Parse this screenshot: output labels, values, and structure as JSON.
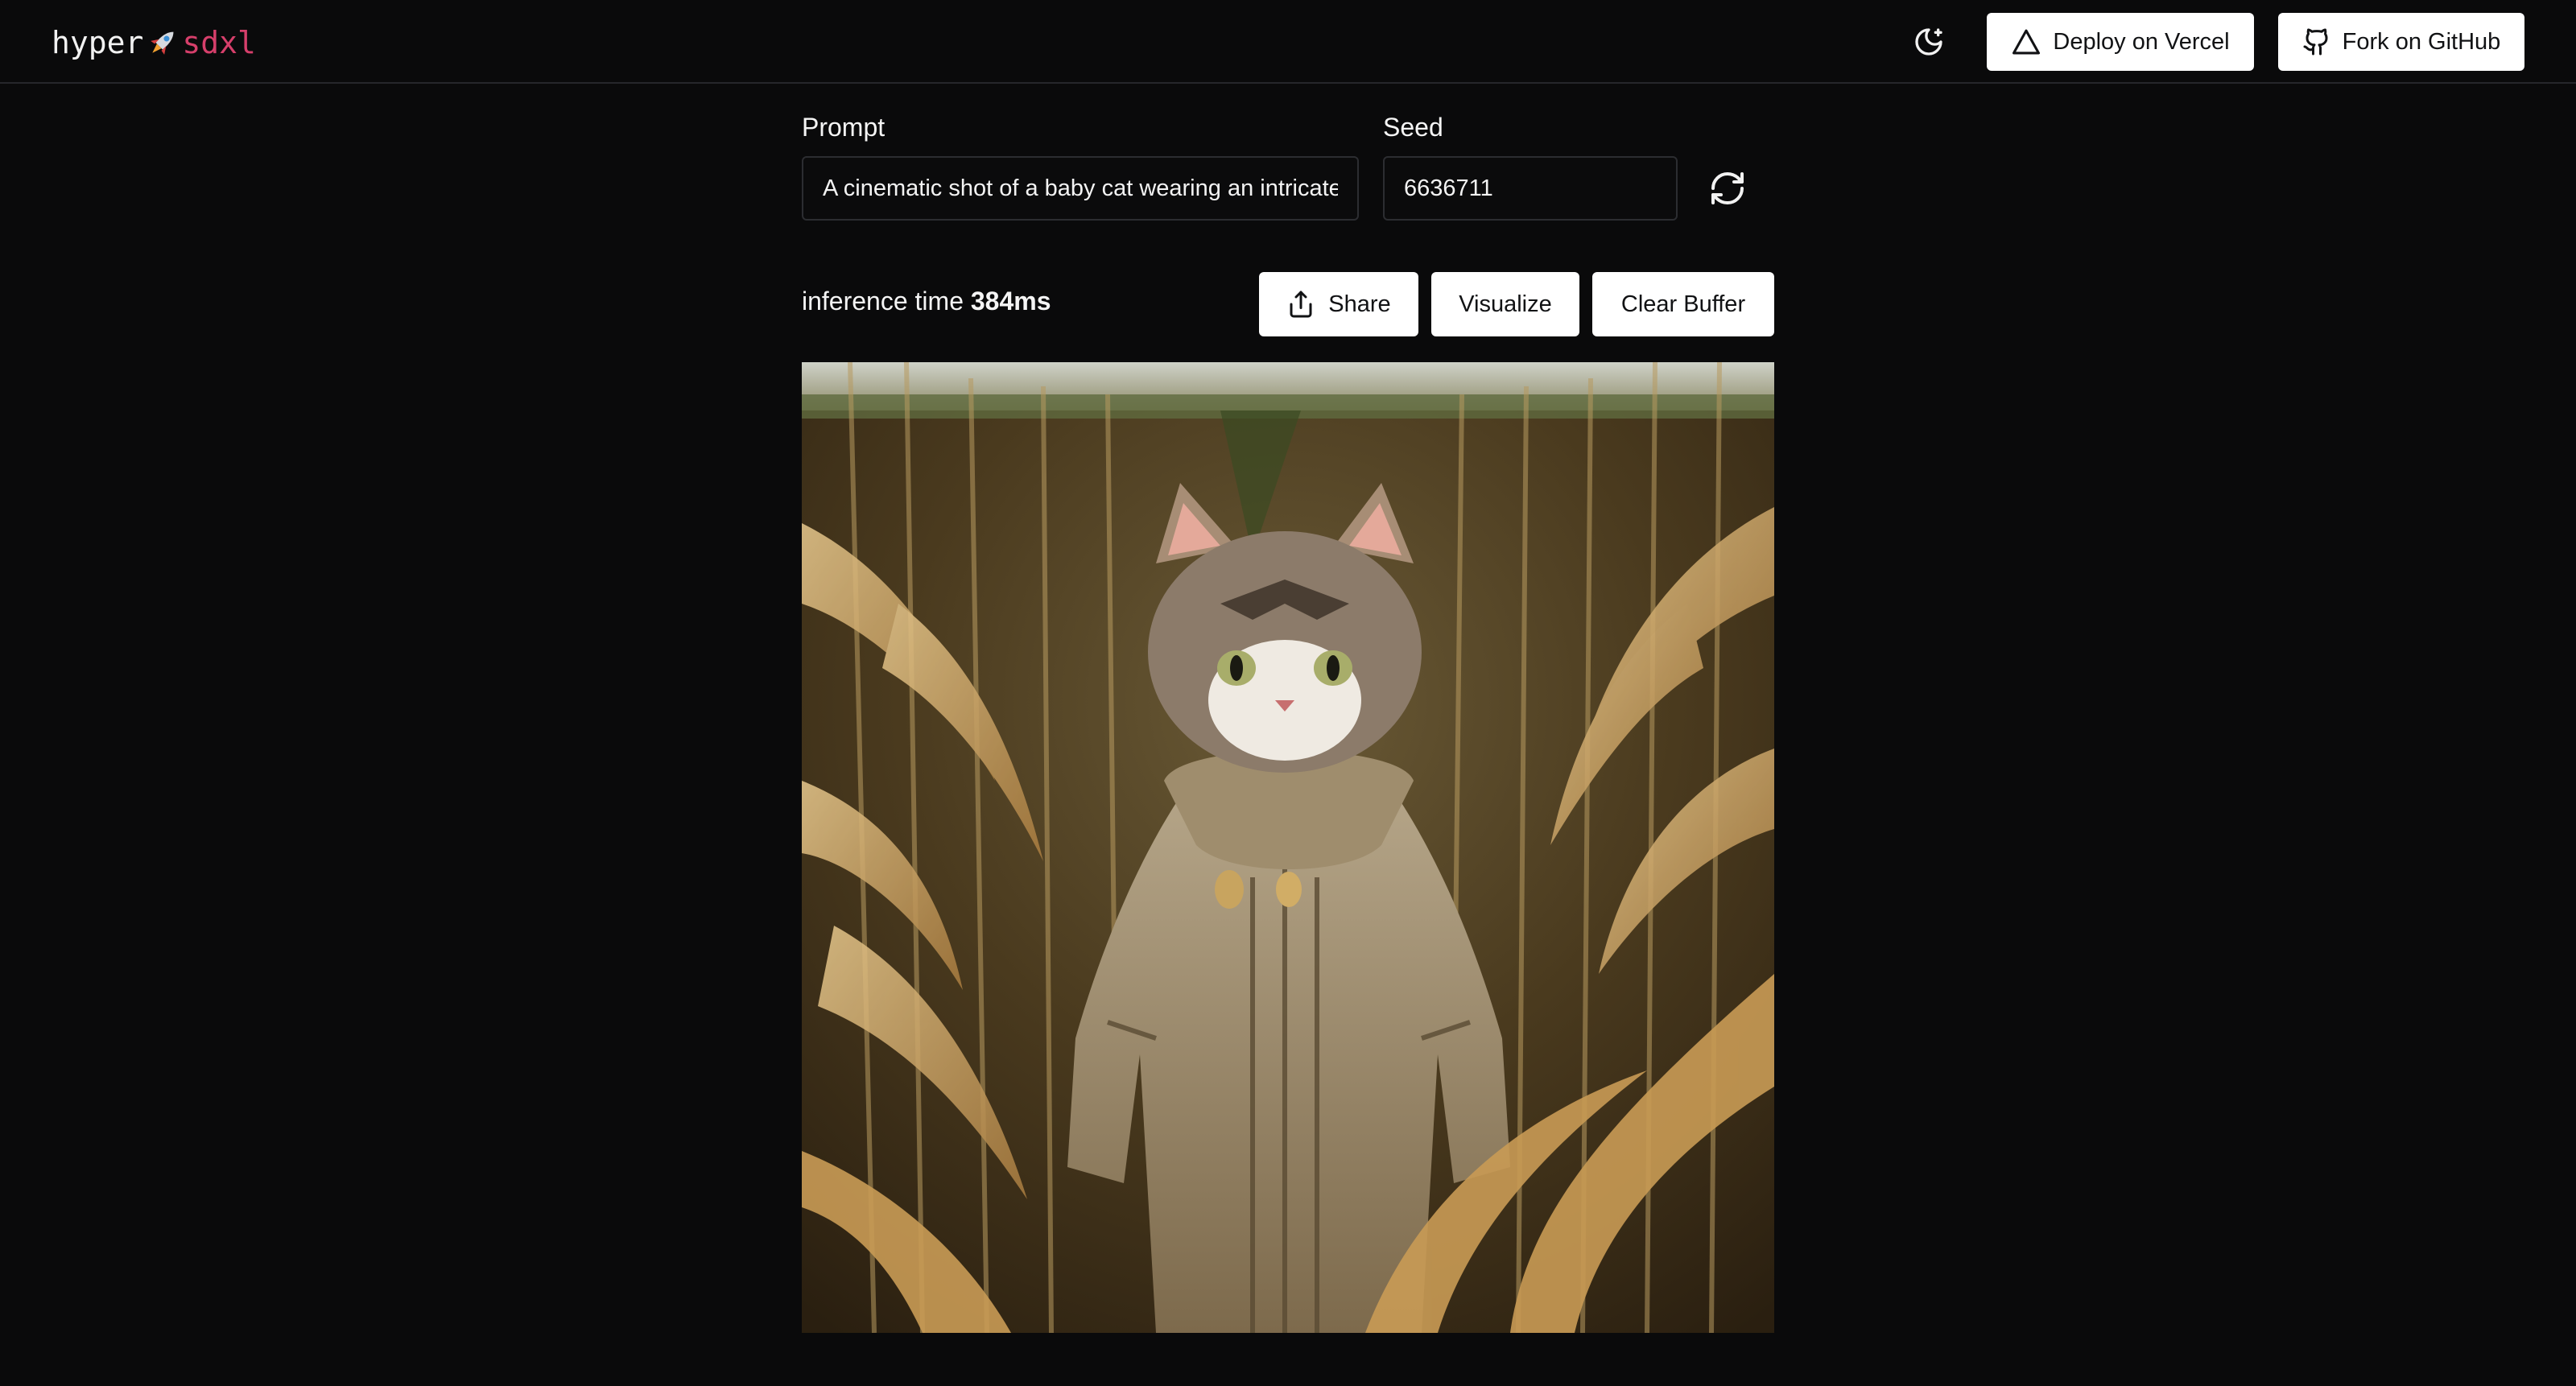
{
  "header": {
    "logo_part1": "hyper",
    "logo_icon": "rocket-emoji",
    "logo_part2": "sdxl",
    "theme_icon": "moon-half-icon",
    "deploy_label": "Deploy on Vercel",
    "deploy_icon": "triangle-icon",
    "fork_label": "Fork on GitHub",
    "fork_icon": "github-icon"
  },
  "form": {
    "prompt_label": "Prompt",
    "prompt_value": "A cinematic shot of a baby cat wearing an intricate italian priest robe",
    "seed_label": "Seed",
    "seed_value": "6636711",
    "refresh_icon": "refresh-icon"
  },
  "toolbar": {
    "inference_label": "inference time",
    "inference_value": "384ms",
    "share_label": "Share",
    "share_icon": "share-icon",
    "visualize_label": "Visualize",
    "clear_label": "Clear Buffer"
  },
  "colors": {
    "background": "#0a0a0b",
    "accent": "#d63f6b",
    "button_bg": "#ffffff"
  }
}
